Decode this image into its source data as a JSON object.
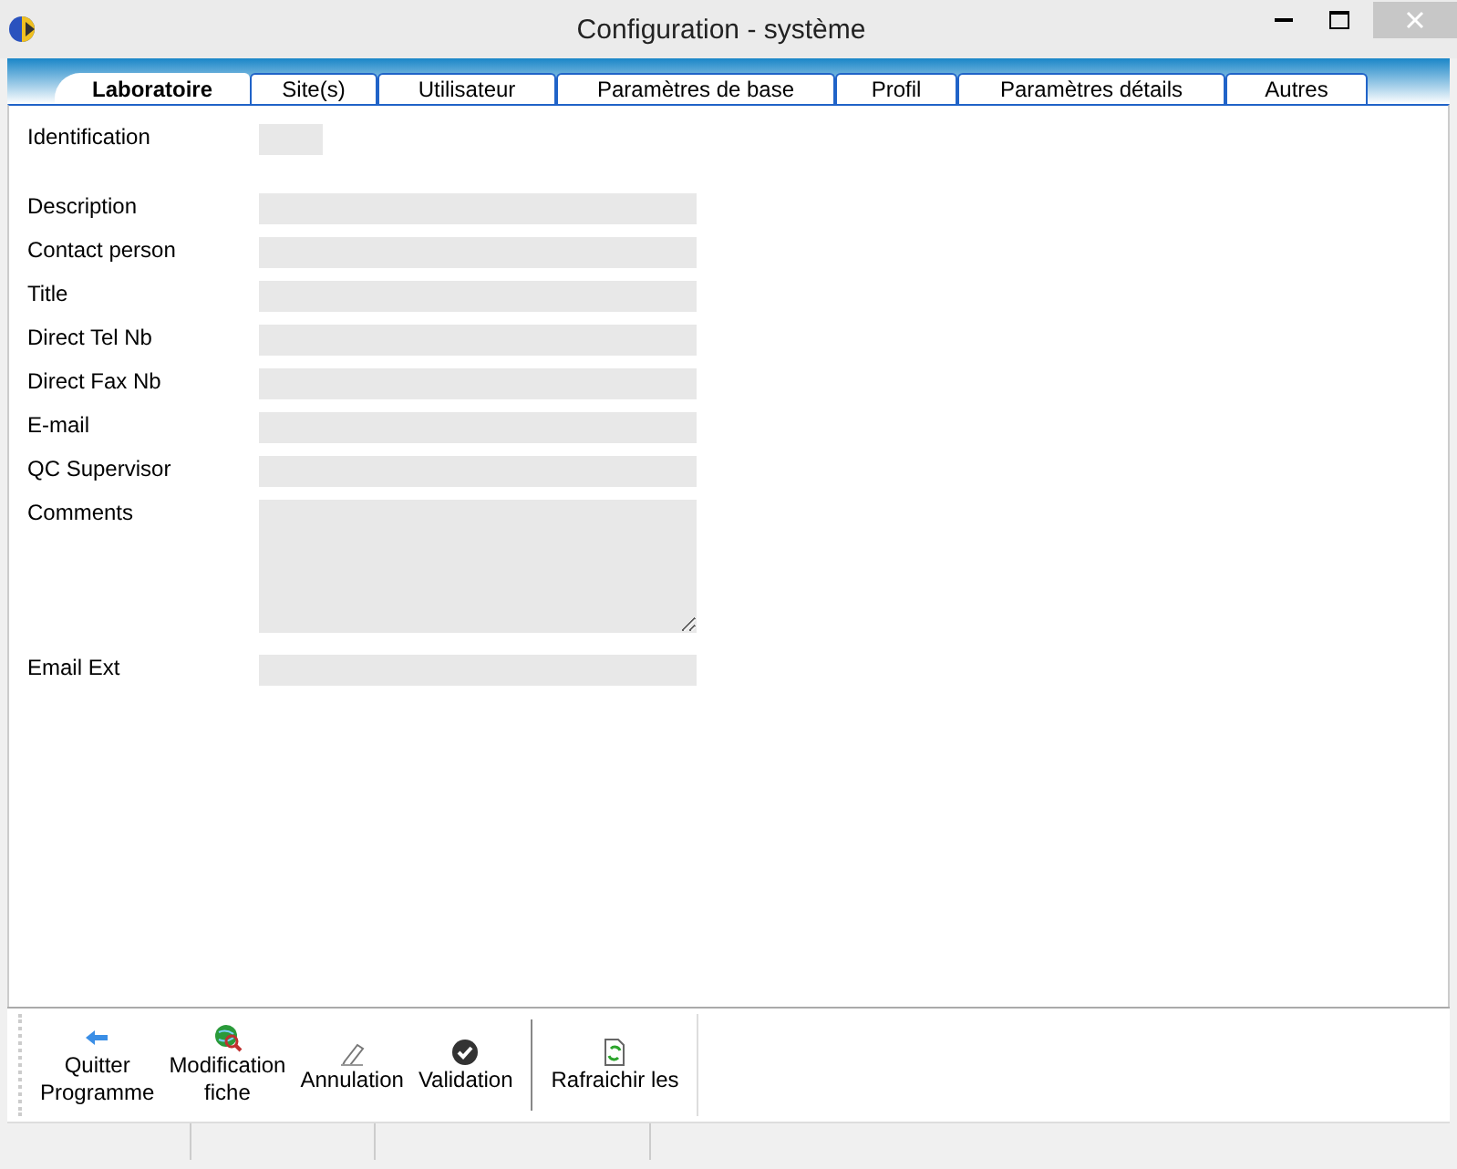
{
  "window": {
    "title": "Configuration - système"
  },
  "tabs": [
    {
      "label": "Laboratoire",
      "selected": true
    },
    {
      "label": "Site(s)",
      "selected": false
    },
    {
      "label": "Utilisateur",
      "selected": false
    },
    {
      "label": "Paramètres de base",
      "selected": false
    },
    {
      "label": "Profil",
      "selected": false
    },
    {
      "label": "Paramètres détails",
      "selected": false
    },
    {
      "label": "Autres",
      "selected": false
    }
  ],
  "fields": [
    {
      "label": "Identification",
      "kind": "short"
    },
    {
      "label": "Description",
      "kind": "line"
    },
    {
      "label": "Contact person",
      "kind": "line"
    },
    {
      "label": "Title",
      "kind": "line"
    },
    {
      "label": "Direct Tel  Nb",
      "kind": "line"
    },
    {
      "label": "Direct Fax  Nb",
      "kind": "line"
    },
    {
      "label": "E-mail",
      "kind": "line"
    },
    {
      "label": "QC Supervisor",
      "kind": "line"
    },
    {
      "label": "Comments",
      "kind": "area"
    },
    {
      "label": "Email Ext",
      "kind": "line"
    }
  ],
  "toolbar": [
    {
      "label": "Quitter\nProgramme",
      "kind": "arrow"
    },
    {
      "label": "Modification\nfiche",
      "kind": "globe"
    },
    {
      "label": "Annulation",
      "kind": "eraser"
    },
    {
      "label": "Validation",
      "kind": "check"
    },
    {
      "label": "Rafraichir les",
      "kind": "refresh"
    }
  ]
}
